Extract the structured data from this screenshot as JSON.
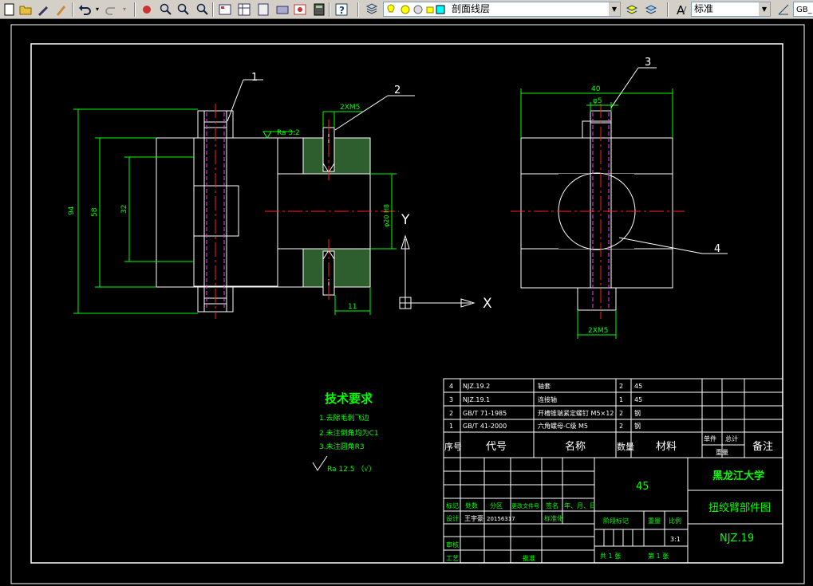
{
  "toolbar": {
    "layer_name": "剖面线层",
    "text_style": "标准",
    "dim_style": "GB_"
  },
  "drawing": {
    "balloons": [
      "1",
      "2",
      "3",
      "4"
    ],
    "dims": {
      "d2xm5": "2XM5",
      "d2xm5b": "2XM5",
      "ra32": "Ra 3.2",
      "d94": "94",
      "d58": "58",
      "d32": "32",
      "d20h8": "φ20 H8",
      "d11": "11",
      "d40": "40",
      "d25": "φ5"
    },
    "axis_y": "Y",
    "axis_x": "X",
    "tech_title": "技术要求",
    "tech_items": [
      "1.去除毛刺飞边",
      "2.未注倒角均为C1",
      "3.未注圆角R3"
    ],
    "tech_ra": "Ra 12.5 （√）"
  },
  "title_block": {
    "parts": [
      {
        "no": "4",
        "code": "NJZ.19.2",
        "name": "轴套",
        "qty": "2",
        "mat": "45"
      },
      {
        "no": "3",
        "code": "NJZ.19.1",
        "name": "连接轴",
        "qty": "1",
        "mat": "45"
      },
      {
        "no": "2",
        "code": "GB/T 71-1985",
        "name": "开槽锥端紧定螺钉 M5×12",
        "qty": "2",
        "mat": "钢"
      },
      {
        "no": "1",
        "code": "GB/T 41-2000",
        "name": "六角螺母-C级 M5",
        "qty": "2",
        "mat": "钢"
      }
    ],
    "header": {
      "no": "序号",
      "code": "代号",
      "name": "名称",
      "qty": "数量",
      "mat": "材料",
      "unit": "单件",
      "total": "总计",
      "weight": "重量",
      "remark": "备注"
    },
    "material": "45",
    "university": "黑龙江大学",
    "drawing_name": "扭绞臂部件图",
    "drawing_code": "NJZ.19",
    "labels": {
      "mark": "标记",
      "count": "处数",
      "zone": "分区",
      "doc": "更改文件号",
      "sign": "签名",
      "date": "年、月、日",
      "design": "设计",
      "designer": "王宇豪",
      "design_date": "20156317",
      "std": "标准化",
      "stage": "阶段标记",
      "weight": "重量",
      "scale": "比例",
      "scale_val": "3:1",
      "check": "审核",
      "craft": "工艺",
      "approve": "批准",
      "sheets": "共 1 张",
      "sheet": "第 1 张"
    }
  }
}
